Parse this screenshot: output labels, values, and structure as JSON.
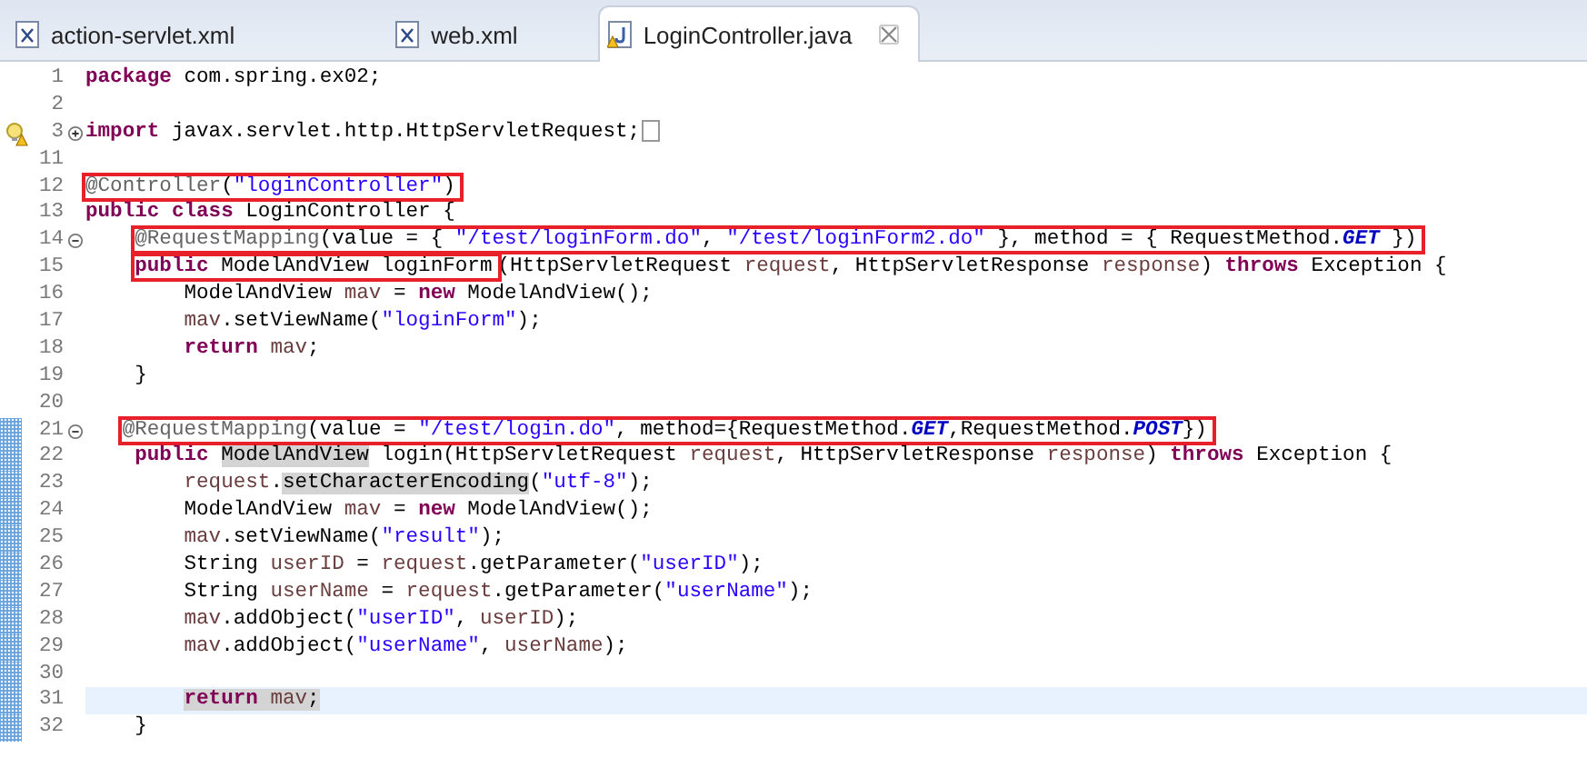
{
  "tabs": [
    {
      "label": "action-servlet.xml",
      "kind": "xml",
      "selected": false,
      "warning": false
    },
    {
      "label": "web.xml",
      "kind": "xml",
      "selected": false,
      "warning": false
    },
    {
      "label": "LoginController.java",
      "kind": "java",
      "selected": true,
      "warning": true
    }
  ],
  "editor": {
    "lines": [
      {
        "number": "1",
        "tokens": [
          {
            "text": "package",
            "kind": "keyword"
          },
          {
            "text": " com.spring.ex02;",
            "kind": "plain"
          }
        ]
      },
      {
        "number": "2"
      },
      {
        "number": "3",
        "folded": true,
        "warning": true,
        "tokens": [
          {
            "text": "import",
            "kind": "keyword"
          },
          {
            "text": " javax.servlet.http.HttpServletRequest;",
            "kind": "plain"
          },
          {
            "kind": "collapsed"
          }
        ]
      },
      {
        "number": "11"
      },
      {
        "number": "12",
        "segments": [
          {
            "boxed": true,
            "tokens": [
              {
                "text": "@Controller",
                "kind": "annotation"
              },
              {
                "text": "(",
                "kind": "plain"
              },
              {
                "text": "\"loginController\"",
                "kind": "string"
              },
              {
                "text": ")",
                "kind": "plain"
              }
            ]
          }
        ]
      },
      {
        "number": "13",
        "tokens": [
          {
            "text": "public class",
            "kind": "keyword"
          },
          {
            "text": " LoginController {",
            "kind": "plain"
          }
        ]
      },
      {
        "number": "14",
        "folded": false,
        "segments": [
          {
            "boxed": true,
            "tokens": [
              {
                "text": "    @RequestMapping",
                "kind": "annotation"
              },
              {
                "text": "(value = { ",
                "kind": "plain"
              },
              {
                "text": "\"/test/loginForm.do\"",
                "kind": "string"
              },
              {
                "text": ", ",
                "kind": "plain"
              },
              {
                "text": "\"/test/loginForm2.do\"",
                "kind": "string"
              },
              {
                "text": " }, method = { RequestMethod.",
                "kind": "plain"
              },
              {
                "text": "GET",
                "kind": "constant"
              },
              {
                "text": " })",
                "kind": "plain"
              }
            ]
          }
        ]
      },
      {
        "number": "15",
        "segments": [
          {
            "boxed": true,
            "tokens": [
              {
                "text": "    public",
                "kind": "keyword"
              },
              {
                "text": " ModelAndView loginForm",
                "kind": "plain"
              }
            ]
          },
          {
            "boxed": false,
            "tokens": [
              {
                "text": "(HttpServletRequest ",
                "kind": "plain"
              },
              {
                "text": "request",
                "kind": "variable"
              },
              {
                "text": ", HttpServletResponse ",
                "kind": "plain"
              },
              {
                "text": "response",
                "kind": "variable"
              },
              {
                "text": ") ",
                "kind": "plain"
              },
              {
                "text": "throws",
                "kind": "keyword"
              },
              {
                "text": " Exception {",
                "kind": "plain"
              }
            ]
          }
        ]
      },
      {
        "number": "16",
        "tokens": [
          {
            "text": "        ModelAndView ",
            "kind": "plain"
          },
          {
            "text": "mav",
            "kind": "variable"
          },
          {
            "text": " = ",
            "kind": "plain"
          },
          {
            "text": "new",
            "kind": "keyword"
          },
          {
            "text": " ModelAndView();",
            "kind": "plain"
          }
        ]
      },
      {
        "number": "17",
        "tokens": [
          {
            "text": "        mav",
            "kind": "variable"
          },
          {
            "text": ".setViewName(",
            "kind": "plain"
          },
          {
            "text": "\"loginForm\"",
            "kind": "string"
          },
          {
            "text": ");",
            "kind": "plain"
          }
        ]
      },
      {
        "number": "18",
        "tokens": [
          {
            "text": "        return",
            "kind": "keyword"
          },
          {
            "text": " mav",
            "kind": "variable"
          },
          {
            "text": ";",
            "kind": "plain"
          }
        ]
      },
      {
        "number": "19",
        "tokens": [
          {
            "text": "    }",
            "kind": "plain"
          }
        ]
      },
      {
        "number": "20"
      },
      {
        "number": "21",
        "folded": false,
        "changed": true,
        "segments": [
          {
            "boxed": true,
            "tokens": [
              {
                "text": "   @RequestMapping",
                "kind": "annotation"
              },
              {
                "text": "(value = ",
                "kind": "plain"
              },
              {
                "text": "\"/test/login.do\"",
                "kind": "string"
              },
              {
                "text": ", method={RequestMethod.",
                "kind": "plain"
              },
              {
                "text": "GET",
                "kind": "constant"
              },
              {
                "text": ",RequestMethod.",
                "kind": "plain"
              },
              {
                "text": "POST",
                "kind": "constant"
              },
              {
                "text": "})",
                "kind": "plain"
              }
            ]
          }
        ]
      },
      {
        "number": "22",
        "changed": true,
        "tokens": [
          {
            "text": "    public ",
            "kind": "keyword"
          },
          {
            "text": "ModelAndView",
            "kind": "plain",
            "marked": true
          },
          {
            "text": " login(HttpServletRequest ",
            "kind": "plain"
          },
          {
            "text": "request",
            "kind": "variable"
          },
          {
            "text": ", HttpServletResponse ",
            "kind": "plain"
          },
          {
            "text": "response",
            "kind": "variable"
          },
          {
            "text": ") ",
            "kind": "plain"
          },
          {
            "text": "throws",
            "kind": "keyword"
          },
          {
            "text": " Exception {",
            "kind": "plain"
          }
        ]
      },
      {
        "number": "23",
        "changed": true,
        "tokens": [
          {
            "text": "        request",
            "kind": "variable"
          },
          {
            "text": ".",
            "kind": "plain"
          },
          {
            "text": "setCharacterEncoding",
            "kind": "plain",
            "marked": true
          },
          {
            "text": "(",
            "kind": "plain"
          },
          {
            "text": "\"utf-8\"",
            "kind": "string"
          },
          {
            "text": ");",
            "kind": "plain"
          }
        ]
      },
      {
        "number": "24",
        "changed": true,
        "tokens": [
          {
            "text": "        ModelAndView ",
            "kind": "plain"
          },
          {
            "text": "mav",
            "kind": "variable"
          },
          {
            "text": " = ",
            "kind": "plain"
          },
          {
            "text": "new",
            "kind": "keyword"
          },
          {
            "text": " ModelAndView();",
            "kind": "plain"
          }
        ]
      },
      {
        "number": "25",
        "changed": true,
        "tokens": [
          {
            "text": "        mav",
            "kind": "variable"
          },
          {
            "text": ".setViewName(",
            "kind": "plain"
          },
          {
            "text": "\"result\"",
            "kind": "string"
          },
          {
            "text": ");",
            "kind": "plain"
          }
        ]
      },
      {
        "number": "26",
        "changed": true,
        "tokens": [
          {
            "text": "        String ",
            "kind": "plain"
          },
          {
            "text": "userID",
            "kind": "variable"
          },
          {
            "text": " = ",
            "kind": "plain"
          },
          {
            "text": "request",
            "kind": "variable"
          },
          {
            "text": ".getParameter(",
            "kind": "plain"
          },
          {
            "text": "\"userID\"",
            "kind": "string"
          },
          {
            "text": ");",
            "kind": "plain"
          }
        ]
      },
      {
        "number": "27",
        "changed": true,
        "tokens": [
          {
            "text": "        String ",
            "kind": "plain"
          },
          {
            "text": "userName",
            "kind": "variable"
          },
          {
            "text": " = ",
            "kind": "plain"
          },
          {
            "text": "request",
            "kind": "variable"
          },
          {
            "text": ".getParameter(",
            "kind": "plain"
          },
          {
            "text": "\"userName\"",
            "kind": "string"
          },
          {
            "text": ");",
            "kind": "plain"
          }
        ]
      },
      {
        "number": "28",
        "changed": true,
        "tokens": [
          {
            "text": "        mav",
            "kind": "variable"
          },
          {
            "text": ".addObject(",
            "kind": "plain"
          },
          {
            "text": "\"userID\"",
            "kind": "string"
          },
          {
            "text": ", ",
            "kind": "plain"
          },
          {
            "text": "userID",
            "kind": "variable"
          },
          {
            "text": ");",
            "kind": "plain"
          }
        ]
      },
      {
        "number": "29",
        "changed": true,
        "tokens": [
          {
            "text": "        mav",
            "kind": "variable"
          },
          {
            "text": ".addObject(",
            "kind": "plain"
          },
          {
            "text": "\"userName\"",
            "kind": "string"
          },
          {
            "text": ", ",
            "kind": "plain"
          },
          {
            "text": "userName",
            "kind": "variable"
          },
          {
            "text": ");",
            "kind": "plain"
          }
        ]
      },
      {
        "number": "30",
        "changed": true
      },
      {
        "number": "31",
        "changed": true,
        "current": true,
        "tokens": [
          {
            "text": "        return ",
            "kind": "keyword",
            "marked": true
          },
          {
            "text": "mav",
            "kind": "variable",
            "marked": true
          },
          {
            "text": ";",
            "kind": "plain",
            "marked": true
          }
        ]
      },
      {
        "number": "32",
        "changed": true,
        "tokens": [
          {
            "text": "    }",
            "kind": "plain"
          }
        ]
      }
    ]
  }
}
